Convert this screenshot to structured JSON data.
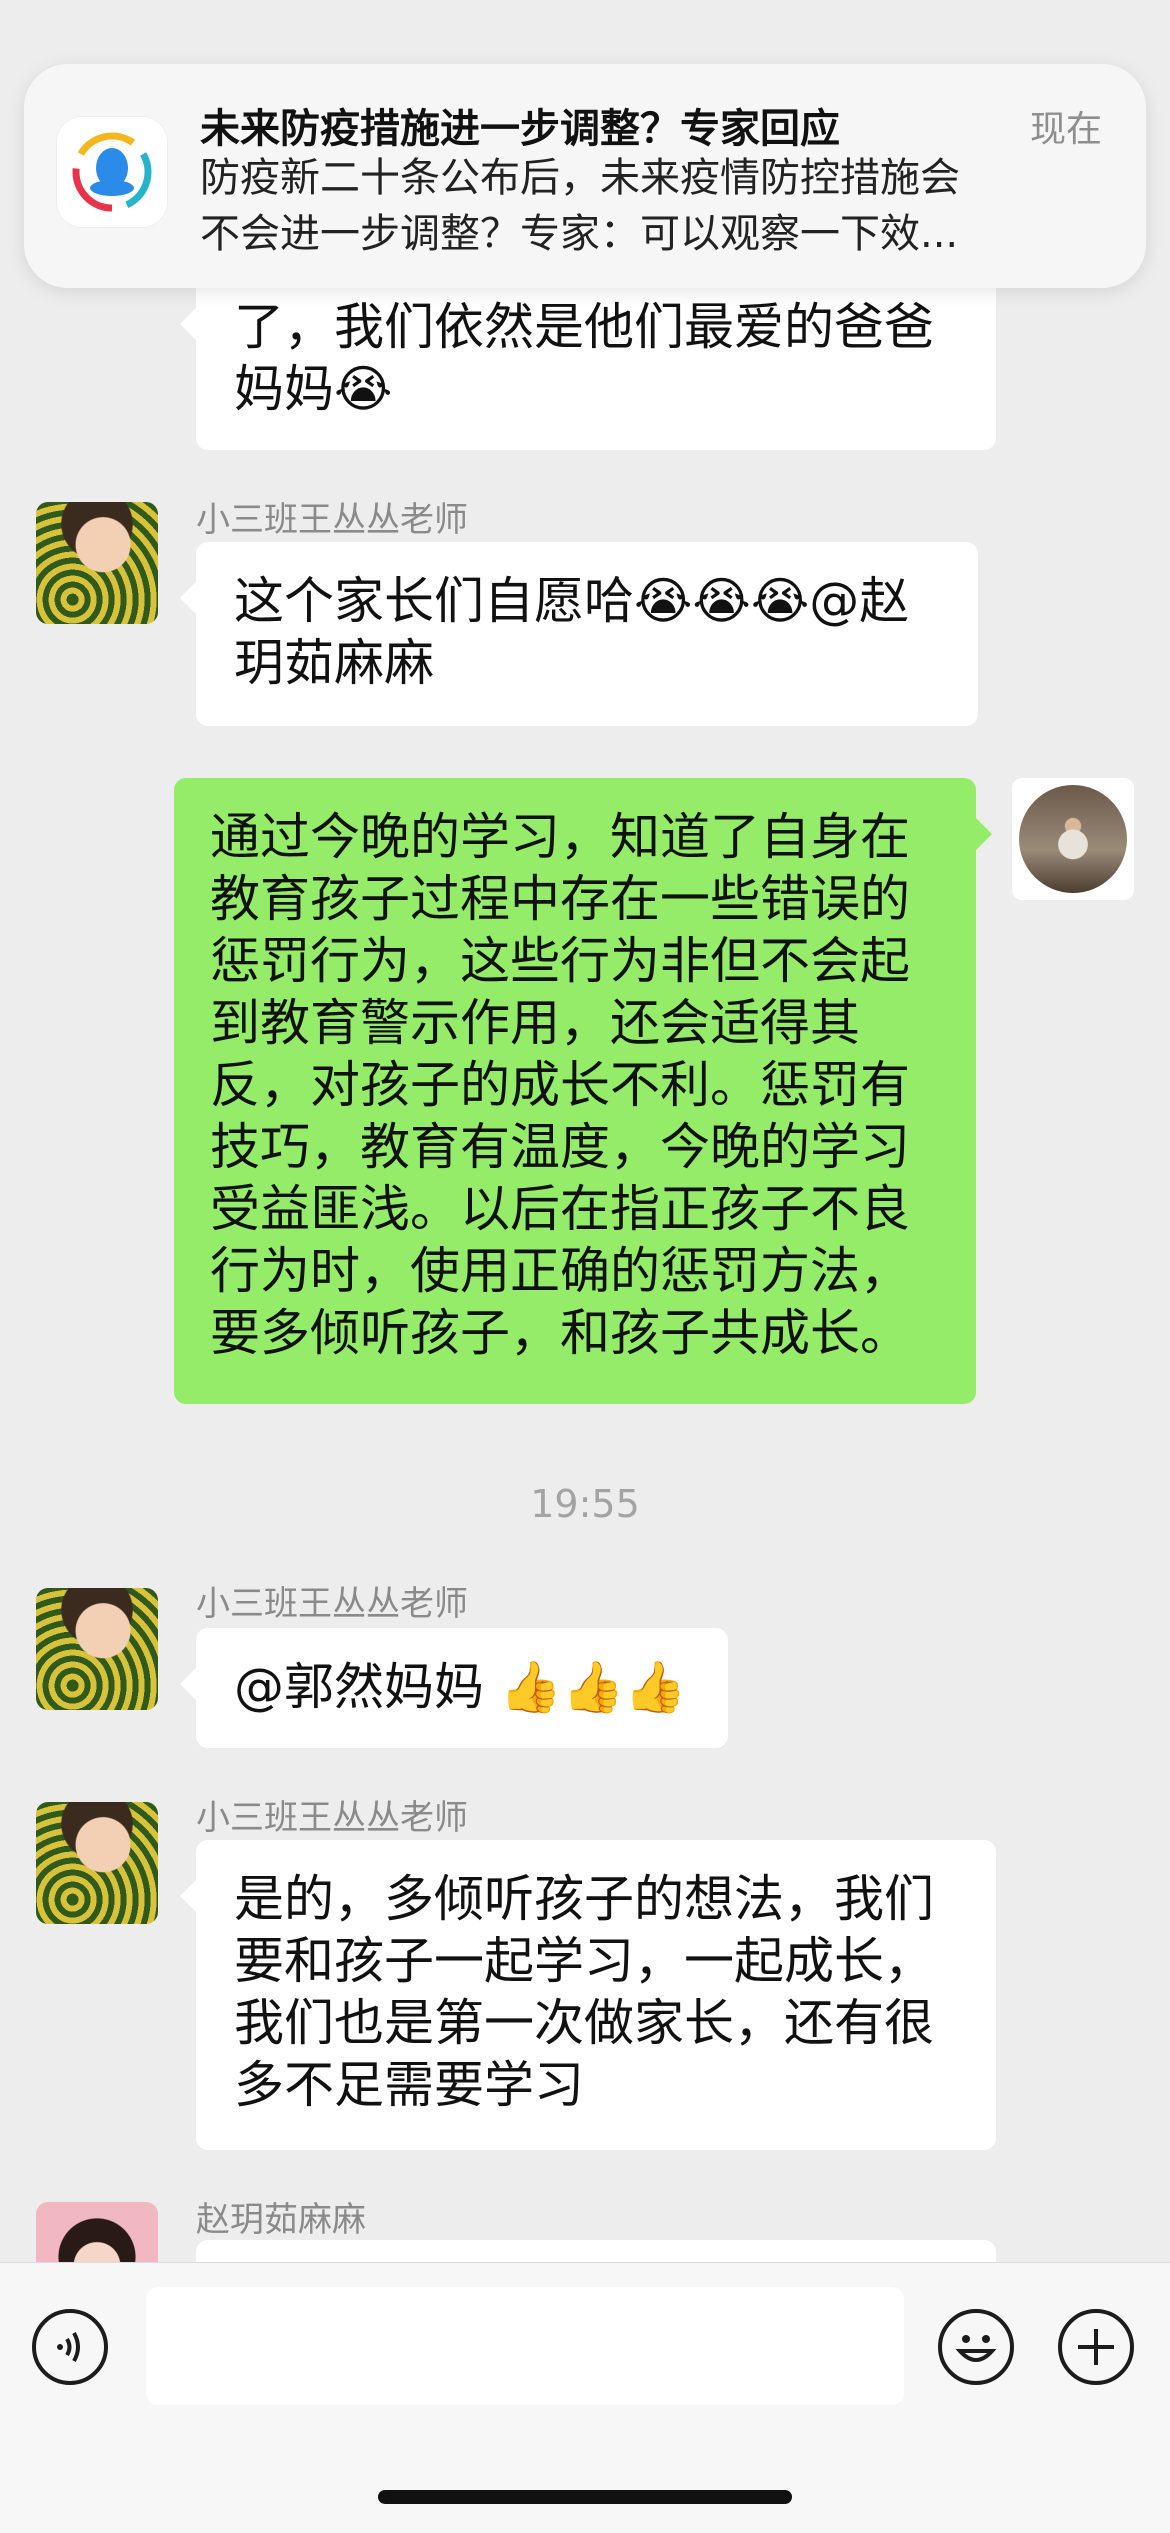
{
  "notification": {
    "title": "未来防疫措施进一步调整？专家回应",
    "time": "现在",
    "line1": "防疫新二十条公布后，未来疫情防控措施会",
    "line2": "不会进一步调整？专家：可以观察一下效..."
  },
  "messages": {
    "m0": {
      "line1": "了，我们依然是他们最爱的爸爸",
      "line2": "妈妈😭"
    },
    "m1": {
      "sender": "小三班王丛丛老师",
      "line1": "这个家长们自愿哈😭😭😭@赵",
      "line2": "玥茹麻麻"
    },
    "m2": {
      "lines": [
        "通过今晚的学习，知道了自身在",
        "教育孩子过程中存在一些错误的",
        "惩罚行为，这些行为非但不会起",
        "到教育警示作用，还会适得其",
        "反，对孩子的成长不利。惩罚有",
        "技巧，教育有温度，今晚的学习",
        "受益匪浅。以后在指正孩子不良",
        "行为时，使用正确的惩罚方法，",
        "要多倾听孩子，和孩子共成长。"
      ]
    },
    "time": "19:55",
    "m3": {
      "sender": "小三班王丛丛老师",
      "text": "@郭然妈妈 👍👍👍"
    },
    "m4": {
      "sender": "小三班王丛丛老师",
      "lines": [
        "是的，多倾听孩子的想法，我们",
        "要和孩子一起学习，一起成长，",
        "我们也是第一次做家长，还有很",
        "多不足需要学习"
      ]
    },
    "m5": {
      "sender": "赵玥茹麻麻"
    }
  },
  "input_bar": {
    "voice_icon": "voice-icon",
    "emoji_icon": "emoji-icon",
    "plus_icon": "plus-icon",
    "input_value": ""
  }
}
